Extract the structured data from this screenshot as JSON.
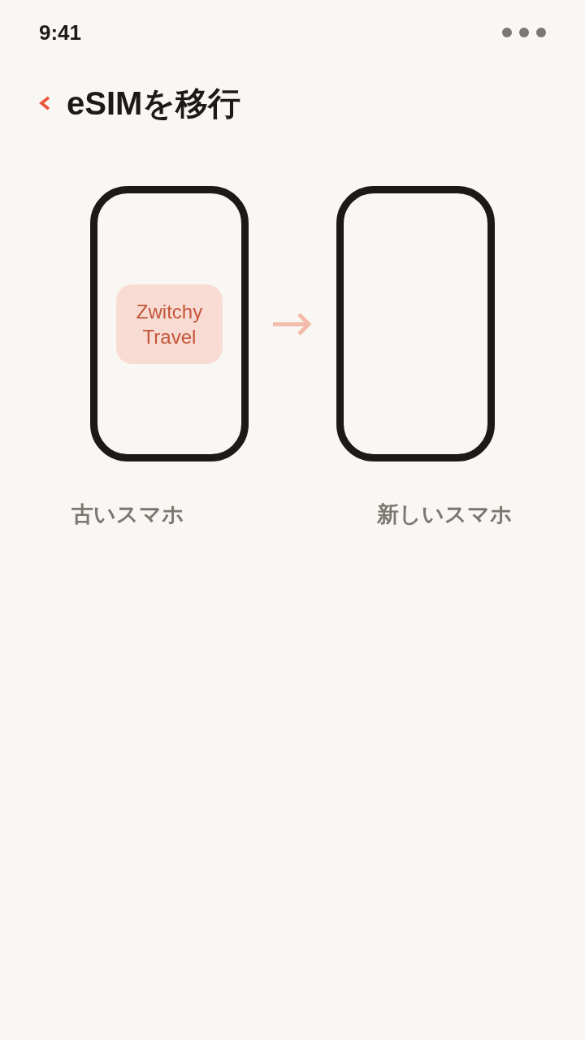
{
  "status_bar": {
    "time": "9:41"
  },
  "header": {
    "title": "eSIMを移行"
  },
  "phones": [
    {
      "label": "古いスマホ",
      "app": {
        "name": "Zwitchy Travel"
      }
    },
    {
      "label": "新しいスマホ"
    }
  ]
}
